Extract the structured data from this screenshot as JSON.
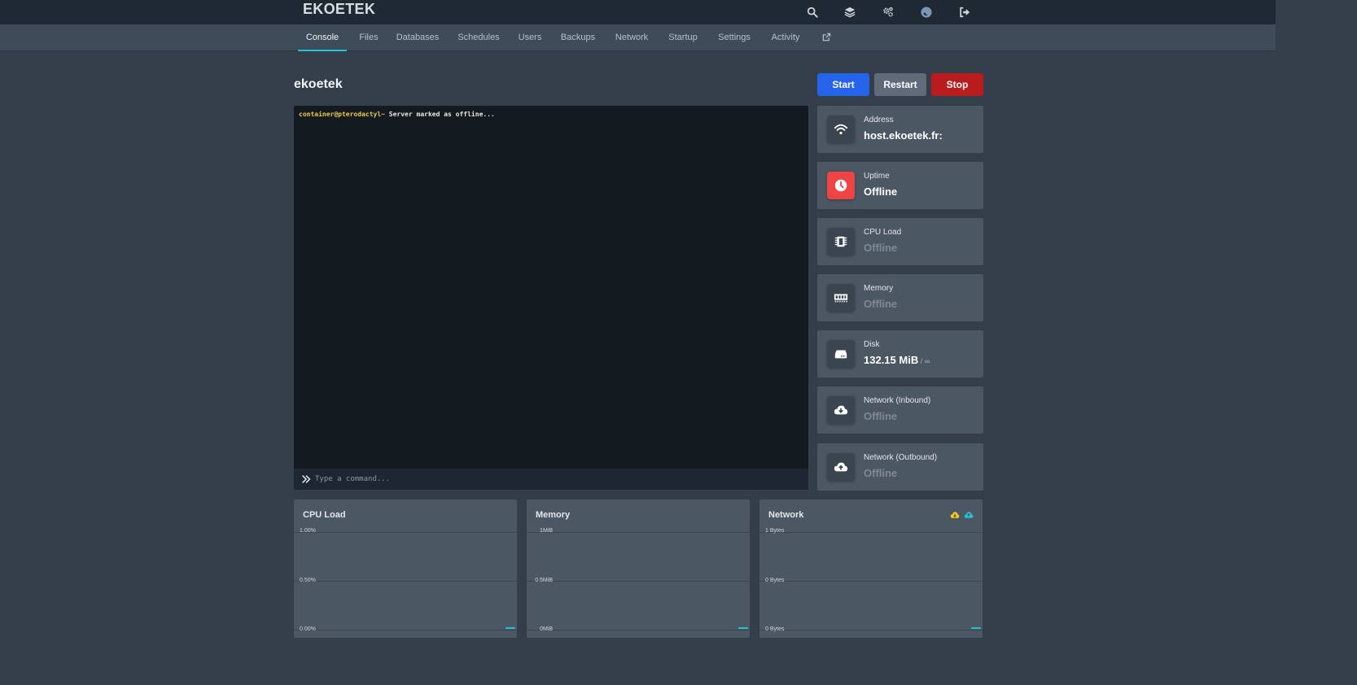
{
  "app": {
    "brand": "EKOETEK"
  },
  "topbar": {
    "icons": [
      "search-icon",
      "layers-icon",
      "cogs-icon",
      "avatar",
      "sign-out-icon"
    ]
  },
  "nav": {
    "tabs": [
      {
        "label": "Console",
        "active": true
      },
      {
        "label": "Files"
      },
      {
        "label": "Databases"
      },
      {
        "label": "Schedules"
      },
      {
        "label": "Users"
      },
      {
        "label": "Backups"
      },
      {
        "label": "Network"
      },
      {
        "label": "Startup"
      },
      {
        "label": "Settings"
      },
      {
        "label": "Activity"
      }
    ],
    "external_icon": "external-link-icon"
  },
  "server": {
    "name": "ekoetek",
    "buttons": {
      "start": "Start",
      "restart": "Restart",
      "stop": "Stop"
    }
  },
  "console": {
    "prompt": "container@pterodactyl~",
    "line": " Server marked as offline...",
    "placeholder": "Type a command..."
  },
  "stats": [
    {
      "label": "Address",
      "value": "host.ekoetek.fr:",
      "icon": "wifi-icon"
    },
    {
      "label": "Uptime",
      "value": "Offline",
      "icon": "clock-icon"
    },
    {
      "label": "CPU Load",
      "value": "Offline",
      "icon": "microchip-icon"
    },
    {
      "label": "Memory",
      "value": "Offline",
      "icon": "memory-icon"
    },
    {
      "label": "Disk",
      "value": "132.15 MiB",
      "suffix": " / ∞",
      "icon": "hdd-icon"
    },
    {
      "label": "Network (Inbound)",
      "value": "Offline",
      "icon": "cloud-download-icon"
    },
    {
      "label": "Network (Outbound)",
      "value": "Offline",
      "icon": "cloud-upload-icon"
    }
  ],
  "colors": {
    "accent": "#22c3d8",
    "start": "#2563eb",
    "restart": "#5f6b78",
    "stop": "#b91c1c",
    "uptime_icon": "#ef4444",
    "legend_inbound": "#facc15",
    "legend_outbound": "#22c3d8"
  },
  "graphs": {
    "cpu": {
      "title": "CPU Load",
      "ticks": [
        "1.00%",
        "0.50%",
        "0.00%"
      ]
    },
    "memory": {
      "title": "Memory",
      "ticks": [
        "1MiB",
        "0.5MiB",
        "0MiB"
      ]
    },
    "network": {
      "title": "Network",
      "ticks": [
        "1 Bytes",
        "0 Bytes",
        "0 Bytes"
      ]
    }
  }
}
